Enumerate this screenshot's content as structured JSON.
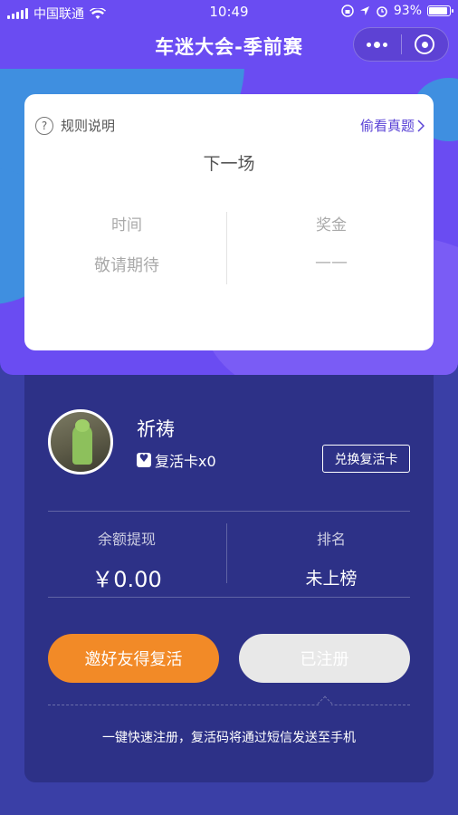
{
  "status_bar": {
    "carrier": "中国联通",
    "time": "10:49",
    "battery_percent": "93%",
    "battery_level": 0.93
  },
  "nav": {
    "title": "车迷大会-季前赛",
    "icons": [
      "more-icon",
      "close-circle-icon"
    ]
  },
  "card": {
    "rules_label": "规则说明",
    "peek_label": "偷看真题",
    "next_label": "下一场",
    "time_label": "时间",
    "time_value": "敬请期待",
    "prize_label": "奖金",
    "prize_value": "——"
  },
  "user": {
    "name": "祈祷",
    "revive_card": "复活卡x0",
    "redeem_button": "兑换复活卡"
  },
  "stats": {
    "balance_label": "余额提现",
    "balance_value": "￥0.00",
    "rank_label": "排名",
    "rank_value": "未上榜"
  },
  "actions": {
    "invite_button": "邀好友得复活",
    "registered_button": "已注册"
  },
  "footer_tip": "一键快速注册，复活码将通过短信发送至手机",
  "colors": {
    "header": "#6a4cf2",
    "panel": "#2d3187",
    "accent_orange": "#f28a27",
    "link_purple": "#5a43d6"
  }
}
